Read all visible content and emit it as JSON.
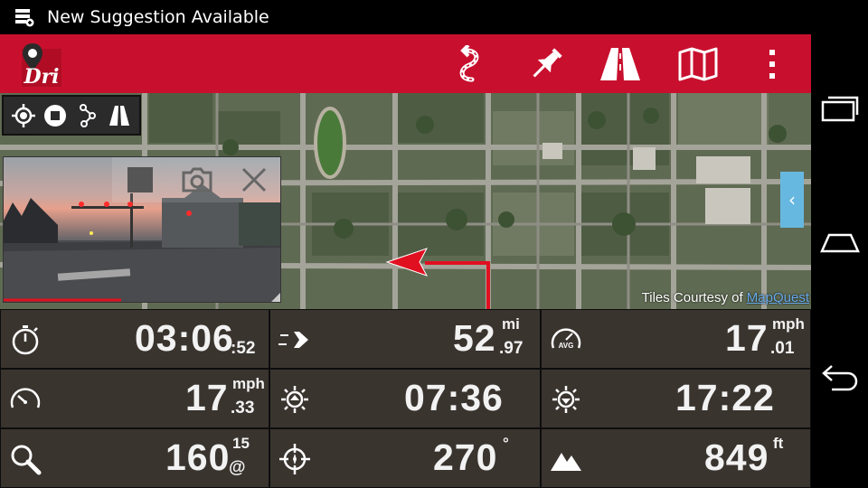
{
  "status": {
    "notification_text": "New Suggestion Available",
    "notification_icon": "notification-list-icon"
  },
  "app": {
    "logo_text": "Dri",
    "accent": "#c8102e",
    "actions": [
      {
        "name": "route-icon"
      },
      {
        "name": "pin-icon"
      },
      {
        "name": "road-icon"
      },
      {
        "name": "map-icon"
      },
      {
        "name": "overflow-menu-icon"
      }
    ]
  },
  "map": {
    "credit_prefix": "Tiles Courtesy of ",
    "credit_link": "MapQuest",
    "drawer_glyph": "‹"
  },
  "dashboard": {
    "trip_time": {
      "value": "03:06",
      "sub": ":52"
    },
    "distance": {
      "value": "52",
      "unit": "mi",
      "sub": ".97"
    },
    "avg_speed": {
      "value": "17",
      "unit": "mph",
      "sub": ".01",
      "icon_label": "AVG"
    },
    "speed": {
      "value": "17",
      "unit": "mph",
      "sub": ".33"
    },
    "sunrise": {
      "value": "07:36"
    },
    "sunset": {
      "value": "17:22"
    },
    "satellites": {
      "value": "160",
      "unit": "15",
      "sub": "@"
    },
    "heading": {
      "value": "270",
      "unit": "°"
    },
    "altitude": {
      "value": "849",
      "unit": "ft"
    }
  }
}
